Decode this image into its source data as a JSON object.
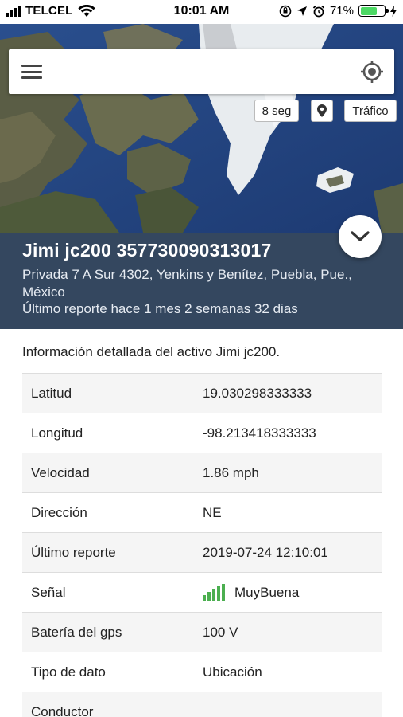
{
  "status_bar": {
    "carrier": "TELCEL",
    "time": "10:01 AM",
    "battery_percent": "71%",
    "battery_level": 0.71,
    "icons": [
      "signal-icon",
      "wifi-icon",
      "orientation-lock-icon",
      "location-arrow-icon",
      "alarm-icon",
      "battery-icon",
      "charging-icon"
    ]
  },
  "map": {
    "menu_icon": "hamburger-menu-icon",
    "locate_icon": "my-location-icon",
    "refresh_label": "8 seg",
    "pin_icon": "map-pin-icon",
    "traffic_label": "Tráfico"
  },
  "asset": {
    "title": "Jimi jc200 357730090313017",
    "address": "Privada 7 A Sur 4302, Yenkins y Benítez, Puebla, Pue., México",
    "last_report": "Último reporte hace 1 mes 2 semanas 32 dias",
    "collapse_icon": "chevron-down-icon"
  },
  "details": {
    "intro": "Información detallada del activo Jimi jc200.",
    "rows": [
      {
        "label": "Latitud",
        "value": "19.030298333333"
      },
      {
        "label": "Longitud",
        "value": "-98.213418333333"
      },
      {
        "label": "Velocidad",
        "value": "1.86 mph"
      },
      {
        "label": "Dirección",
        "value": "NE"
      },
      {
        "label": "Último reporte",
        "value": "2019-07-24 12:10:01"
      },
      {
        "label": "Señal",
        "value": "MuyBuena"
      },
      {
        "label": "Batería del gps",
        "value": "100 V"
      },
      {
        "label": "Tipo de dato",
        "value": "Ubicación"
      },
      {
        "label": "Conductor",
        "value": ""
      }
    ]
  },
  "colors": {
    "panel_bg": "#34475f",
    "signal_green": "#4caf50",
    "battery_green": "#4cd964"
  }
}
